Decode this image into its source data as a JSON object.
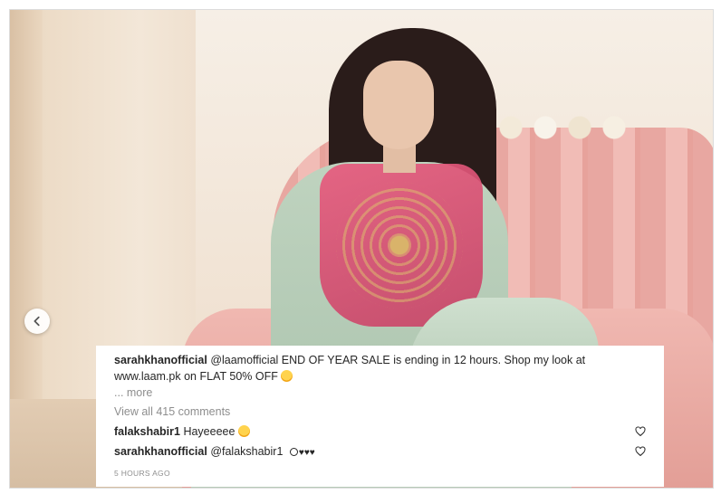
{
  "post": {
    "author": "sarahkhanofficial",
    "caption_mention": "@laamofficial",
    "caption_text_line1": "END OF YEAR SALE is ending in 12 hours. Shop my look at",
    "caption_text_line2": "www.laam.pk on FLAT 50% OFF",
    "more_label": "... more",
    "view_all_comments": "View all 415 comments",
    "timestamp": "5 HOURS AGO"
  },
  "comments": [
    {
      "username": "falakshabir1",
      "text": "Hayeeeee"
    },
    {
      "username": "sarahkhanofficial",
      "text": "@falakshabir1",
      "hearts": "♥♥♥"
    }
  ],
  "icons": {
    "prev": "chevron-left-icon",
    "like": "heart-outline-icon",
    "emoji": "smiling-face-emoji"
  },
  "colors": {
    "text": "#262626",
    "muted": "#8e8e8e",
    "panel": "#ffffff"
  }
}
